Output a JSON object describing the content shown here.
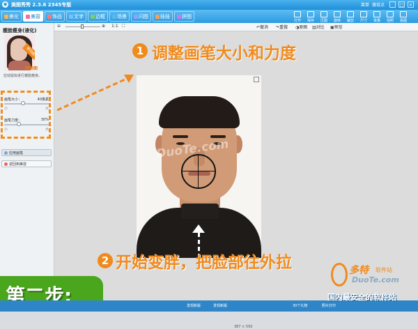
{
  "window": {
    "title": "美图秀秀 2.3.6 2345专版",
    "menu": [
      "菜单",
      "搜说点"
    ],
    "controls": [
      "_",
      "□",
      "×"
    ]
  },
  "nav": {
    "tabs": [
      {
        "label": "美化",
        "active": false,
        "color": "#ffb34d"
      },
      {
        "label": "美容",
        "active": true,
        "color": "#f26fa0"
      },
      {
        "label": "饰品",
        "active": false,
        "color": "#ff7a6e"
      },
      {
        "label": "文字",
        "active": false,
        "color": "#6ec6ff"
      },
      {
        "label": "边框",
        "active": false,
        "color": "#7fd05c"
      },
      {
        "label": "场景",
        "active": false,
        "color": "#58b8e6"
      },
      {
        "label": "闪图",
        "active": false,
        "color": "#8fa2ff"
      },
      {
        "label": "娃娃",
        "active": false,
        "color": "#ff9e4d"
      },
      {
        "label": "拼图",
        "active": false,
        "color": "#c47cf0"
      }
    ],
    "tools": [
      "打开",
      "保存",
      "压图",
      "旋转",
      "裁剪",
      "尺寸",
      "批量",
      "拍照",
      "看图"
    ]
  },
  "sidebar": {
    "title": "瘦脸瘦身(液化)",
    "ribbon": "新功能",
    "effect_label": "效果图",
    "desc": "拉动鼠标进行瘦脸瘦身。",
    "brush_size": {
      "label": "画笔大小：",
      "value": "40像素",
      "level": 0.4,
      "lo": "小",
      "hi": "大"
    },
    "brush_strength": {
      "label": "画笔力度：",
      "value": "30%",
      "level": 0.3,
      "lo": "小",
      "hi": "大"
    },
    "apply_button": "应用画笔",
    "back_button": "返回到美容"
  },
  "editbar": {
    "zoom": "1:1",
    "undo": "撤消",
    "redo": "重做",
    "original": "原图",
    "compare": "对比",
    "preview": "预览"
  },
  "canvas": {
    "watermark": "DuoTe.com",
    "dimensions": "387 × 550"
  },
  "annotations": {
    "step1_num": "1",
    "step1_text": "调整画笔大小和力度",
    "step2_num": "2",
    "step2_text": "开始变胖，把脸部往外拉",
    "step_banner": "第二步:"
  },
  "branding": {
    "name": "多特",
    "sub": "软件站",
    "site": "DuoTe.com",
    "slogan": "国内最安全的软件站"
  },
  "statusbar": {
    "left1": "发现新版",
    "left2": "发现新版",
    "mid": "30个礼物",
    "right": "照片打印"
  },
  "colors": {
    "accent": "#f08a1c",
    "nav": "#2c9ae0",
    "banner": "#4aa61c"
  }
}
